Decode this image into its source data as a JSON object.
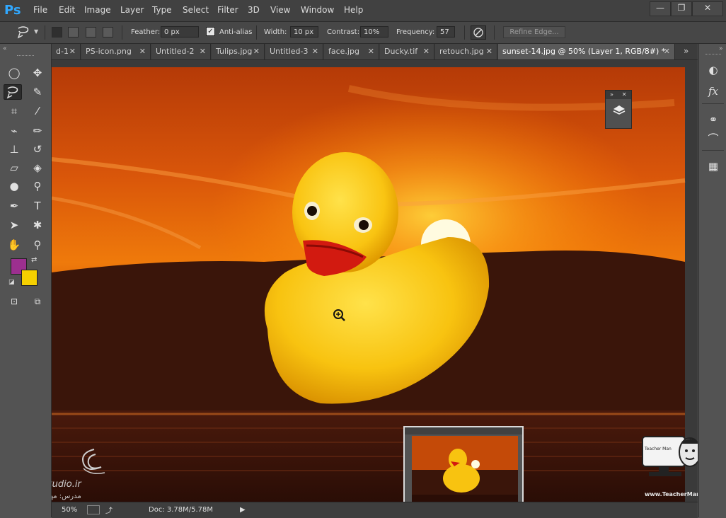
{
  "app": {
    "logo": "Ps"
  },
  "menu": [
    "File",
    "Edit",
    "Image",
    "Layer",
    "Type",
    "Select",
    "Filter",
    "3D",
    "View",
    "Window",
    "Help"
  ],
  "window_controls": {
    "minimize": "—",
    "restore": "❐",
    "close": "✕"
  },
  "options": {
    "feather_label": "Feather:",
    "feather_value": "0 px",
    "antialias_label": "Anti-alias",
    "antialias_checked": true,
    "width_label": "Width:",
    "width_value": "10 px",
    "contrast_label": "Contrast:",
    "contrast_value": "10%",
    "frequency_label": "Frequency:",
    "frequency_value": "57",
    "refine_edge": "Refine Edge..."
  },
  "tabs": [
    {
      "label": "d-1",
      "close": "✕"
    },
    {
      "label": "PS-icon.png",
      "close": "✕"
    },
    {
      "label": "Untitled-2",
      "close": "✕"
    },
    {
      "label": "Tulips.jpg",
      "close": "✕"
    },
    {
      "label": "Untitled-3",
      "close": "✕"
    },
    {
      "label": "face.jpg",
      "close": "✕"
    },
    {
      "label": "Ducky.tif",
      "close": "✕"
    },
    {
      "label": "retouch.jpg",
      "close": "✕"
    },
    {
      "label": "sunset-14.jpg @ 50% (Layer 1, RGB/8#) *",
      "close": "✕",
      "active": true
    }
  ],
  "tab_overflow": "»",
  "status": {
    "zoom": "50%",
    "doc": "Doc: 3.78M/5.78M",
    "arrow": "▶"
  },
  "colors": {
    "foreground": "#9c2f8f",
    "background": "#f5d000",
    "accent": "#31a8ff"
  },
  "watermarks": {
    "left_brand": "safaStudio.ir",
    "left_sub": "مدرس: مهندس فدائی",
    "right_brand": "www.TeacherMan.ir",
    "right_logo_text": "Teacher Man"
  }
}
